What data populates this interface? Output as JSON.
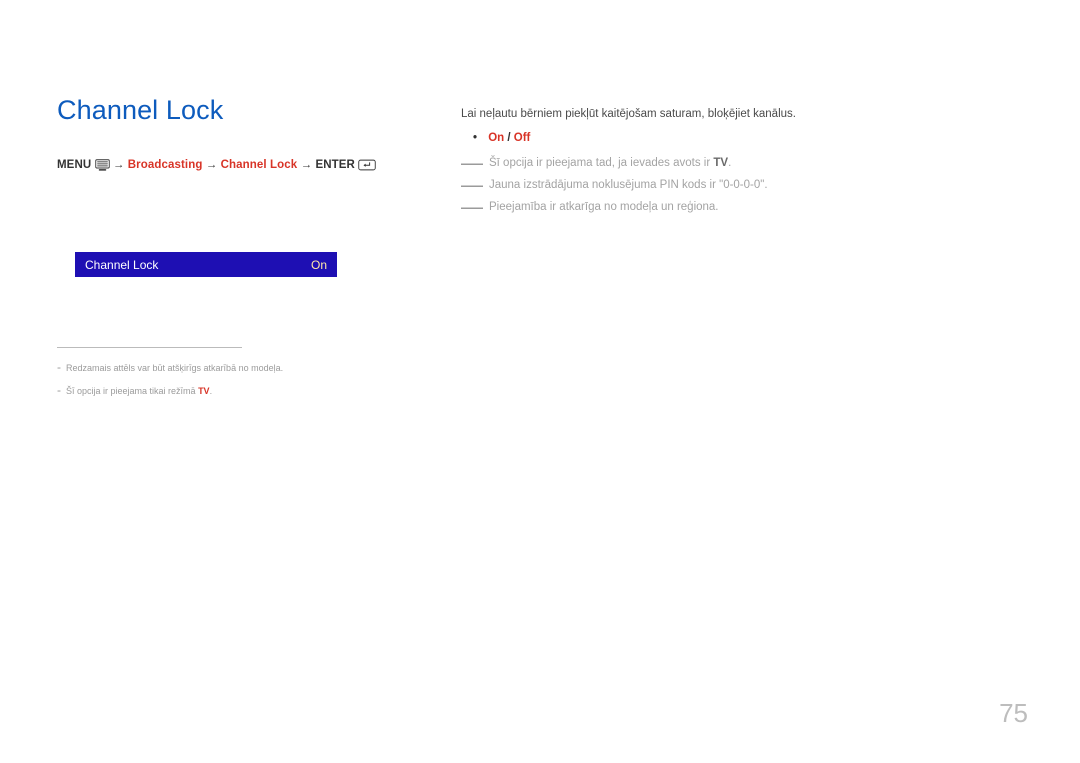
{
  "heading": "Channel Lock",
  "navpath": {
    "menu": "MENU",
    "arrow": "→",
    "broadcasting": "Broadcasting",
    "channelLock": "Channel Lock",
    "enter": "ENTER"
  },
  "uiMock": {
    "label": "Channel Lock",
    "value": "On"
  },
  "footnotes": {
    "line1": "Redzamais attēls var būt atšķirīgs atkarībā no modeļa.",
    "line2_pre": "Šī opcija ir pieejama tikai režīmā ",
    "line2_tv": "TV",
    "line2_post": "."
  },
  "right": {
    "intro": "Lai neļautu bērniem piekļūt kaitējošam saturam, bloķējiet kanālus.",
    "on": "On",
    "off": "Off",
    "note1_pre": "Šī opcija ir pieejama tad, ja ievades avots ir ",
    "note1_tv": "TV",
    "note1_post": ".",
    "note2": "Jauna izstrādājuma noklusējuma PIN kods ir \"0-0-0-0\".",
    "note3": "Pieejamība ir atkarīga no modeļa un reģiona."
  },
  "pageNumber": "75"
}
